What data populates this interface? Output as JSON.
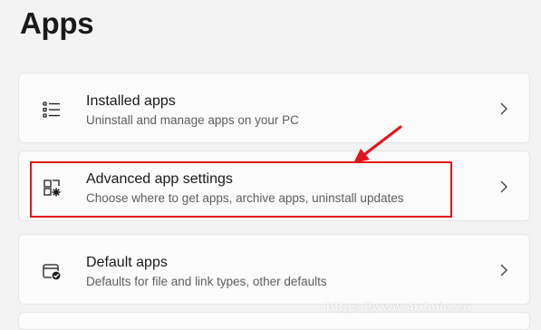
{
  "page": {
    "title": "Apps"
  },
  "items": [
    {
      "title": "Installed apps",
      "description": "Uninstall and manage apps on your PC",
      "icon": "installed-apps-list-icon"
    },
    {
      "title": "Advanced app settings",
      "description": "Choose where to get apps, archive apps, uninstall updates",
      "icon": "advanced-app-settings-icon"
    },
    {
      "title": "Default apps",
      "description": "Defaults for file and link types, other defaults",
      "icon": "default-apps-icon"
    }
  ],
  "annotation": {
    "highlight_color": "#e0141e"
  },
  "watermark": {
    "text": "https://www.4rdmin.co"
  }
}
